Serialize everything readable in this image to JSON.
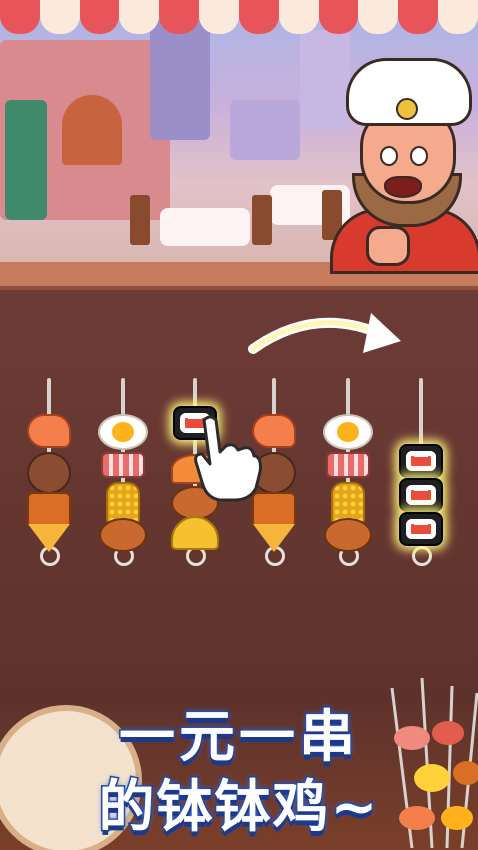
{
  "caption": {
    "line1": "一元一串",
    "line2": "的钵钵鸡~"
  },
  "colors": {
    "awning_red": "#e7545a",
    "awning_white": "#fbe9dc",
    "board": "#6d3b35",
    "caption_fill": "#ffffff",
    "caption_stroke": "#1b3a8c",
    "highlight": "#fff47a"
  },
  "skewers": [
    {
      "name": "skewer-1",
      "items": [
        "shrimp",
        "takoyaki",
        "fried-tofu",
        "pizza"
      ]
    },
    {
      "name": "skewer-2",
      "items": [
        "fried-egg",
        "bacon",
        "corn",
        "roast-chicken"
      ]
    },
    {
      "name": "skewer-3",
      "items": [
        "sushi-roll",
        "fried-fish",
        "roast-chicken",
        "taco"
      ],
      "selected": true
    },
    {
      "name": "skewer-4",
      "items": [
        "shrimp",
        "takoyaki",
        "fried-tofu",
        "pizza"
      ]
    },
    {
      "name": "skewer-5",
      "items": [
        "fried-egg",
        "bacon",
        "corn",
        "roast-chicken"
      ]
    },
    {
      "name": "skewer-6",
      "items": [
        "sushi-roll",
        "sushi-roll",
        "sushi-roll"
      ],
      "highlighted": true
    }
  ],
  "icons": {
    "arrow": "curved-arrow-icon",
    "pointer": "pointing-hand-icon",
    "chef": "chef-character"
  }
}
